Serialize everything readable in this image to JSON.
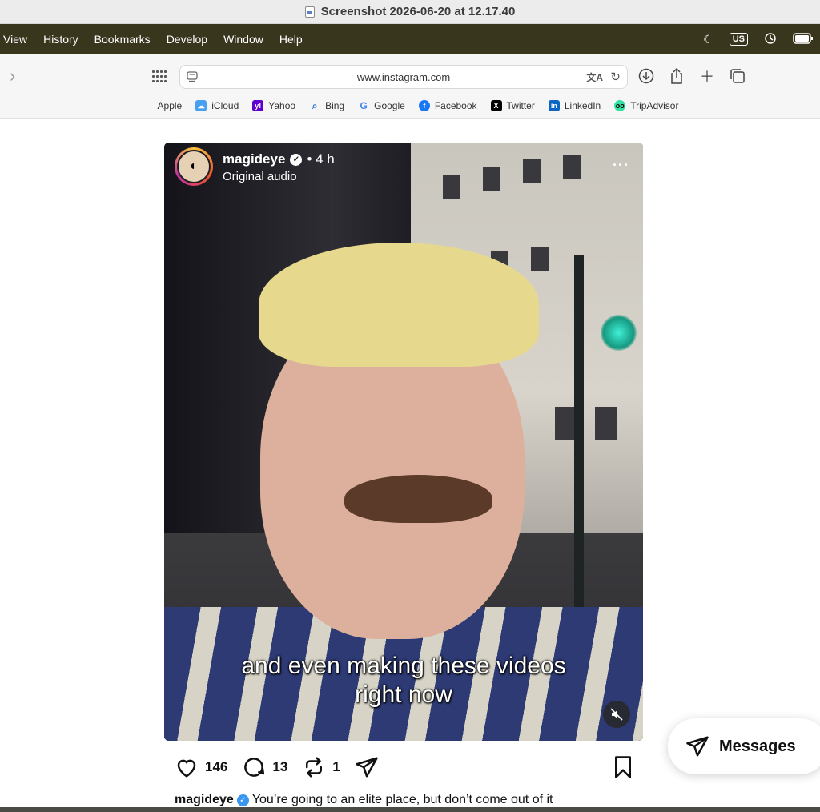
{
  "window": {
    "title": "Screenshot 2026-06-20 at 12.17.40"
  },
  "menubar": {
    "items": [
      "View",
      "History",
      "Bookmarks",
      "Develop",
      "Window",
      "Help"
    ],
    "input_source": "US"
  },
  "browser": {
    "url": "www.instagram.com",
    "favorites": [
      {
        "label": "Apple",
        "icon": "apple-icon",
        "color": "#111111"
      },
      {
        "label": "iCloud",
        "icon": "cloud-icon",
        "color": "#4aa0f0"
      },
      {
        "label": "Yahoo",
        "icon": "yahoo-icon",
        "color": "#6001d2"
      },
      {
        "label": "Bing",
        "icon": "search-icon",
        "color": "#2f6fd6"
      },
      {
        "label": "Google",
        "icon": "google-icon",
        "color": "#4285f4"
      },
      {
        "label": "Facebook",
        "icon": "facebook-icon",
        "color": "#1877f2"
      },
      {
        "label": "Twitter",
        "icon": "x-icon",
        "color": "#000000"
      },
      {
        "label": "LinkedIn",
        "icon": "linkedin-icon",
        "color": "#0a66c2"
      },
      {
        "label": "TripAdvisor",
        "icon": "owl-icon",
        "color": "#34e0a1"
      }
    ]
  },
  "post": {
    "username": "magideye",
    "time": "• 4 h",
    "audio": "Original audio",
    "subtitle_line1": "and even making these videos",
    "subtitle_line2": "right now",
    "likes": "146",
    "comments": "13",
    "reposts": "1",
    "caption_user": "magideye",
    "caption_text": "You’re going to an elite place, but don’t come out of it"
  },
  "messages": {
    "label": "Messages"
  },
  "colors": {
    "menubar": "#39361e",
    "verified_blue": "#3897f0"
  }
}
